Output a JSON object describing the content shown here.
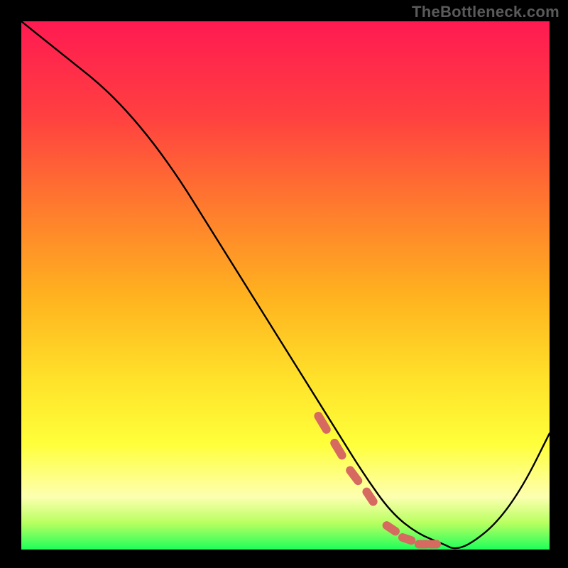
{
  "watermark": "TheBottleneck.com",
  "chart_data": {
    "type": "line",
    "title": "",
    "xlabel": "",
    "ylabel": "",
    "xlim": [
      0,
      100
    ],
    "ylim": [
      0,
      100
    ],
    "grid": false,
    "series": [
      {
        "name": "curve",
        "x": [
          0,
          5,
          10,
          15,
          20,
          25,
          30,
          35,
          40,
          45,
          50,
          55,
          60,
          65,
          70,
          75,
          80,
          82,
          85,
          90,
          95,
          100
        ],
        "values": [
          100,
          96,
          92,
          88,
          83,
          77,
          70,
          62,
          54,
          46,
          38,
          30,
          22,
          14,
          7,
          3,
          1,
          0,
          1,
          5,
          12,
          22
        ]
      },
      {
        "name": "highlight-dashes",
        "x": [
          57,
          60,
          63,
          66,
          70,
          73,
          76,
          78
        ],
        "values": [
          24,
          19,
          14,
          10,
          4,
          2,
          1,
          1
        ]
      }
    ],
    "gradient_stops": [
      {
        "offset": 0.0,
        "color": "#ff1a52"
      },
      {
        "offset": 0.18,
        "color": "#ff4040"
      },
      {
        "offset": 0.35,
        "color": "#ff7a2e"
      },
      {
        "offset": 0.52,
        "color": "#ffb21f"
      },
      {
        "offset": 0.68,
        "color": "#ffe22a"
      },
      {
        "offset": 0.8,
        "color": "#ffff3a"
      },
      {
        "offset": 0.9,
        "color": "#fdffb0"
      },
      {
        "offset": 0.95,
        "color": "#b8ff60"
      },
      {
        "offset": 1.0,
        "color": "#1eff5a"
      }
    ]
  }
}
